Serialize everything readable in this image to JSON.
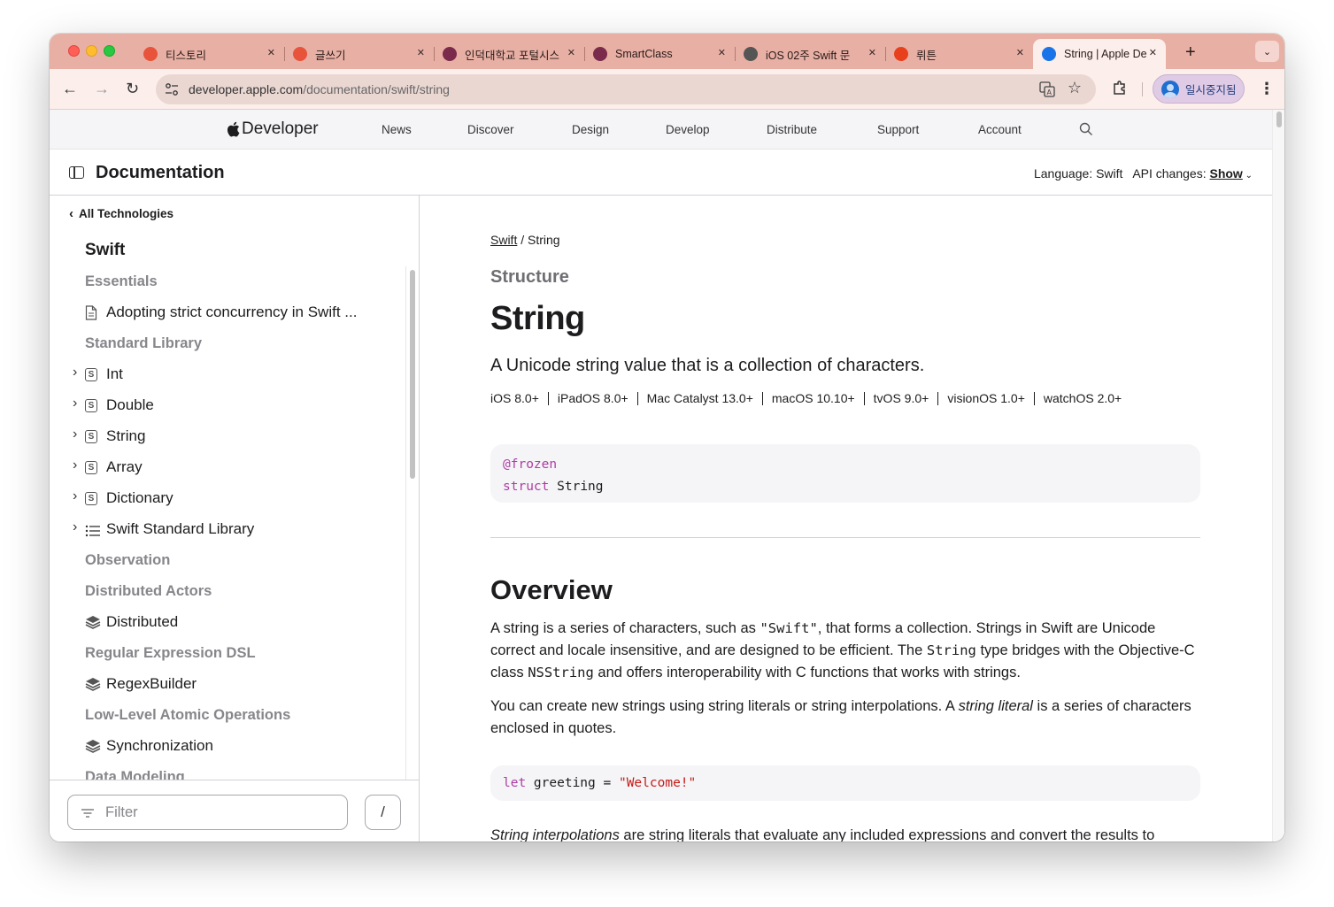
{
  "browser": {
    "tabs": [
      {
        "title": "티스토리",
        "favicon": "tistory-icon",
        "color": "#e8533b"
      },
      {
        "title": "글쓰기",
        "favicon": "tistory-icon",
        "color": "#e8533b"
      },
      {
        "title": "인덕대학교 포털시스",
        "favicon": "induk-icon",
        "color": "#7a2a4a"
      },
      {
        "title": "SmartClass",
        "favicon": "induk-icon",
        "color": "#7a2a4a"
      },
      {
        "title": "iOS 02주 Swift 문",
        "favicon": "globe-icon",
        "color": "#555555"
      },
      {
        "title": "뤼튼",
        "favicon": "wrtn-icon",
        "color": "#e8401c"
      },
      {
        "title": "String | Apple De",
        "favicon": "apple-dev-icon",
        "color": "#1a73e8"
      }
    ],
    "active_tab": 6,
    "url_host": "developer.apple.com",
    "url_path": "/documentation/swift/string",
    "profile_label": "일시중지됨"
  },
  "globalnav": {
    "logo_text": "Developer",
    "items": [
      "News",
      "Discover",
      "Design",
      "Develop",
      "Distribute",
      "Support",
      "Account"
    ]
  },
  "docbar": {
    "title": "Documentation",
    "language_label": "Language:",
    "language_value": "Swift",
    "api_changes_label": "API changes:",
    "api_changes_value": "Show"
  },
  "sidebar": {
    "back_label": "All Technologies",
    "title": "Swift",
    "items": [
      {
        "type": "group",
        "label": "Essentials"
      },
      {
        "type": "item",
        "icon": "article-icon",
        "label": "Adopting strict concurrency in Swift ..."
      },
      {
        "type": "group",
        "label": "Standard Library"
      },
      {
        "type": "item",
        "icon": "structure-icon",
        "expandable": true,
        "label": "Int"
      },
      {
        "type": "item",
        "icon": "structure-icon",
        "expandable": true,
        "label": "Double"
      },
      {
        "type": "item",
        "icon": "structure-icon",
        "expandable": true,
        "label": "String"
      },
      {
        "type": "item",
        "icon": "structure-icon",
        "expandable": true,
        "label": "Array"
      },
      {
        "type": "item",
        "icon": "structure-icon",
        "expandable": true,
        "label": "Dictionary"
      },
      {
        "type": "item",
        "icon": "list-icon",
        "expandable": true,
        "label": "Swift Standard Library"
      },
      {
        "type": "group",
        "label": "Observation"
      },
      {
        "type": "group",
        "label": "Distributed Actors"
      },
      {
        "type": "item",
        "icon": "framework-icon",
        "label": "Distributed"
      },
      {
        "type": "group",
        "label": "Regular Expression DSL"
      },
      {
        "type": "item",
        "icon": "framework-icon",
        "label": "RegexBuilder"
      },
      {
        "type": "group",
        "label": "Low-Level Atomic Operations"
      },
      {
        "type": "item",
        "icon": "framework-icon",
        "label": "Synchronization"
      },
      {
        "type": "group",
        "label": "Data Modeling"
      }
    ],
    "filter_placeholder": "Filter",
    "filter_shortcut": "/"
  },
  "main": {
    "breadcrumb_root": "Swift",
    "breadcrumb_sep": "/",
    "breadcrumb_current": "String",
    "kind": "Structure",
    "title": "String",
    "abstract": "A Unicode string value that is a collection of characters.",
    "availability": [
      "iOS 8.0+",
      "iPadOS 8.0+",
      "Mac Catalyst 13.0+",
      "macOS 10.10+",
      "tvOS 9.0+",
      "visionOS 1.0+",
      "watchOS 2.0+"
    ],
    "declaration_attr": "@frozen",
    "declaration_kw": "struct",
    "declaration_name": "String",
    "overview_heading": "Overview",
    "p1_a": "A string is a series of characters, such as ",
    "p1_code1": "\"Swift\"",
    "p1_b": ", that forms a collection. Strings in Swift are Unicode correct and locale insensitive, and are designed to be efficient. The ",
    "p1_code2": "String",
    "p1_c": " type bridges with the Objective-C class ",
    "p1_code3": "NSString",
    "p1_d": " and offers interoperability with C functions that works with strings.",
    "p2_a": "You can create new strings using string literals or string interpolations. A ",
    "p2_em": "string literal",
    "p2_b": " is a series of characters enclosed in quotes.",
    "code_kw": "let",
    "code_mid": " greeting = ",
    "code_str": "\"Welcome!\"",
    "p3_em": "String interpolations",
    "p3_a": " are string literals that evaluate any included expressions and convert the results to"
  }
}
